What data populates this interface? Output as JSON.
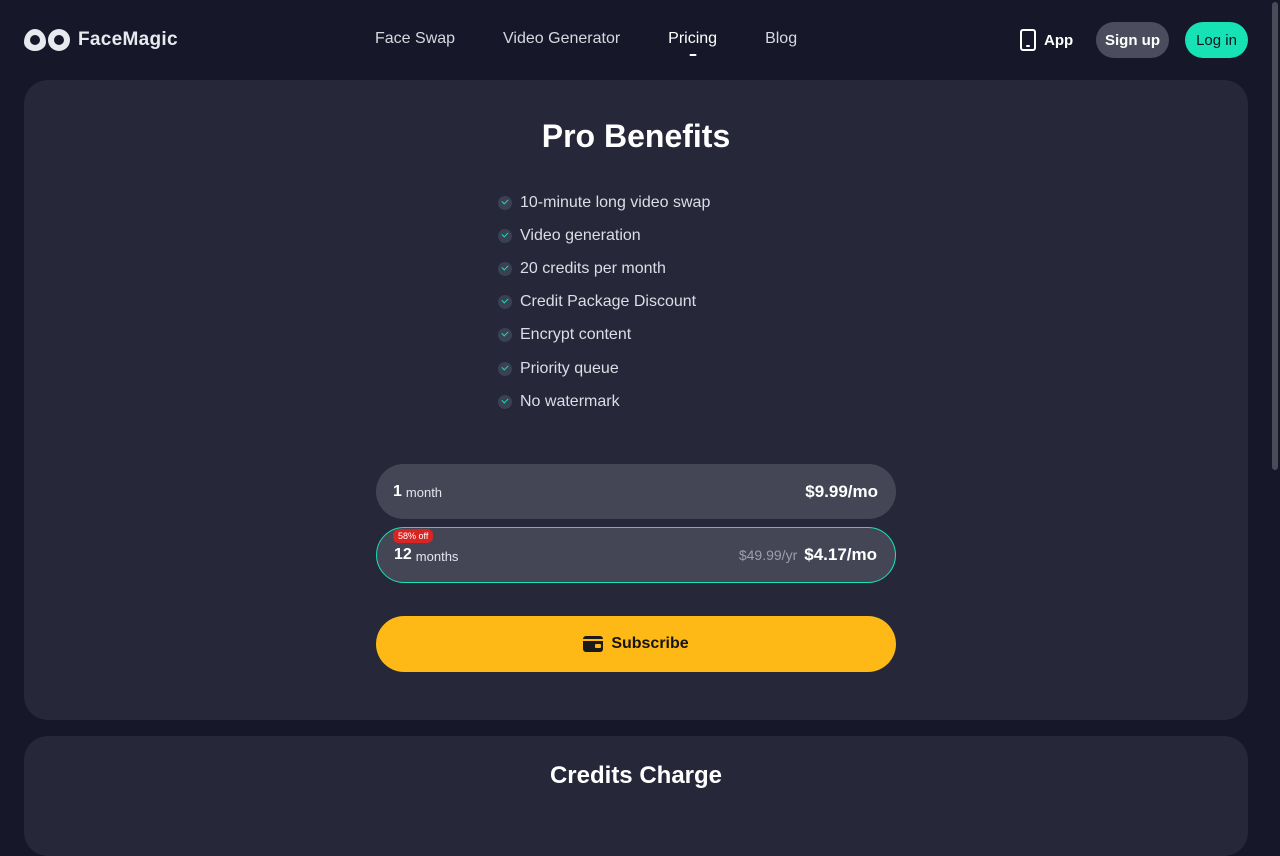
{
  "header": {
    "brand": "FaceMagic",
    "nav": [
      {
        "label": "Face Swap",
        "active": false
      },
      {
        "label": "Video Generator",
        "active": false
      },
      {
        "label": "Pricing",
        "active": true
      },
      {
        "label": "Blog",
        "active": false
      }
    ],
    "app_label": "App",
    "signup_label": "Sign up",
    "login_label": "Log in"
  },
  "pro": {
    "title": "Pro Benefits",
    "benefits": [
      "10-minute long video swap",
      "Video generation",
      "20 credits per month",
      "Credit Package Discount",
      "Encrypt content",
      "Priority queue",
      "No watermark"
    ],
    "plans": [
      {
        "duration": "1",
        "unit": "month",
        "price": "$9.99/mo",
        "selected": false
      },
      {
        "duration": "12",
        "unit": "months",
        "badge": "58% off",
        "original": "$49.99/yr",
        "price": "$4.17/mo",
        "selected": true
      }
    ],
    "subscribe_label": "Subscribe"
  },
  "credits": {
    "title": "Credits Charge"
  },
  "colors": {
    "background": "#161729",
    "card": "#262739",
    "accent": "#17e2b5",
    "cta": "#ffb916",
    "badge": "#d92424"
  },
  "icons": [
    "logo-icon",
    "phone-icon",
    "check-icon",
    "wallet-icon"
  ]
}
